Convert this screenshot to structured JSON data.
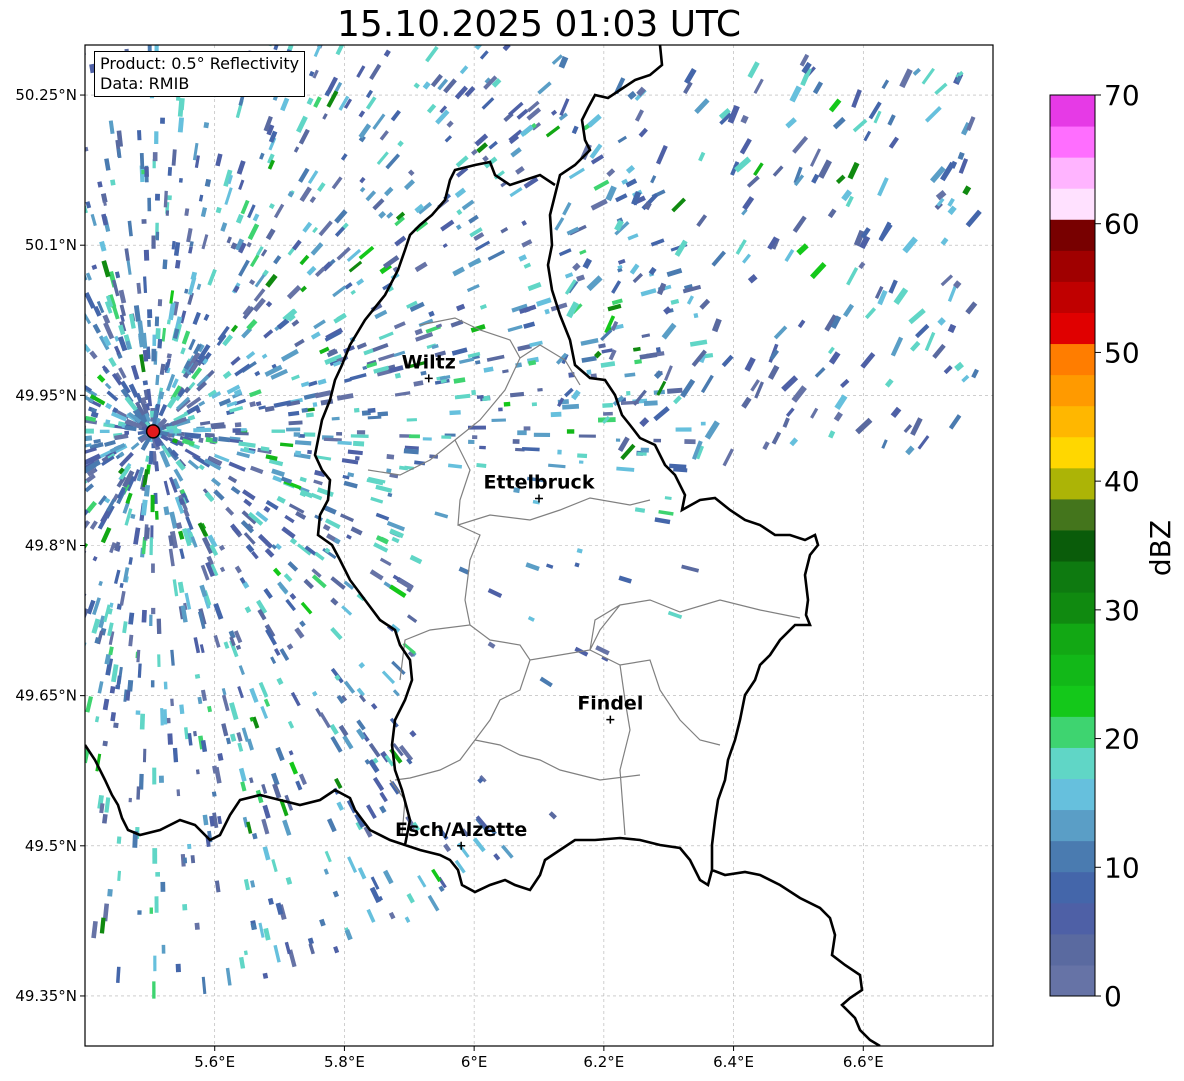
{
  "title": "15.10.2025 01:03 UTC",
  "info_box": {
    "product": "Product: 0.5° Reflectivity",
    "source": "Data: RMIB"
  },
  "axes": {
    "lon_ticks": [
      "5.6°E",
      "5.8°E",
      "6°E",
      "6.2°E",
      "6.4°E",
      "6.6°E"
    ],
    "lat_ticks": [
      "50.25°N",
      "50.1°N",
      "49.95°N",
      "49.8°N",
      "49.65°N",
      "49.5°N",
      "49.35°N"
    ],
    "lon_range": [
      5.4,
      6.8
    ],
    "lat_range": [
      49.3,
      50.3
    ],
    "grid": true
  },
  "cities": [
    {
      "name": "Wiltz",
      "lon": 5.93,
      "lat": 49.967
    },
    {
      "name": "Ettelbruck",
      "lon": 6.1,
      "lat": 49.847
    },
    {
      "name": "Findel",
      "lon": 6.21,
      "lat": 49.626
    },
    {
      "name": "Esch/Alzette",
      "lon": 5.98,
      "lat": 49.5
    }
  ],
  "radar_site": {
    "lon": 5.505,
    "lat": 49.914,
    "color": "#e31a1c"
  },
  "colorbar": {
    "label": "dBZ",
    "ticks": [
      "0",
      "10",
      "20",
      "30",
      "40",
      "50",
      "60",
      "70"
    ],
    "range": [
      0,
      70
    ],
    "colors": [
      "#6673a6",
      "#5a6aa0",
      "#4e60a6",
      "#4466aa",
      "#4a7bb0",
      "#5a9ec6",
      "#66c0dd",
      "#60d6c6",
      "#3ed470",
      "#14c81a",
      "#12b818",
      "#12a814",
      "#108a10",
      "#0e7a10",
      "#0a5c0a",
      "#44751c",
      "#acb406",
      "#ffd700",
      "#ffb700",
      "#ff9a00",
      "#ff7d00",
      "#e00000",
      "#c00000",
      "#a00000",
      "#780000",
      "#ffe1ff",
      "#ffb4ff",
      "#ff6eff",
      "#e63ae6"
    ]
  }
}
